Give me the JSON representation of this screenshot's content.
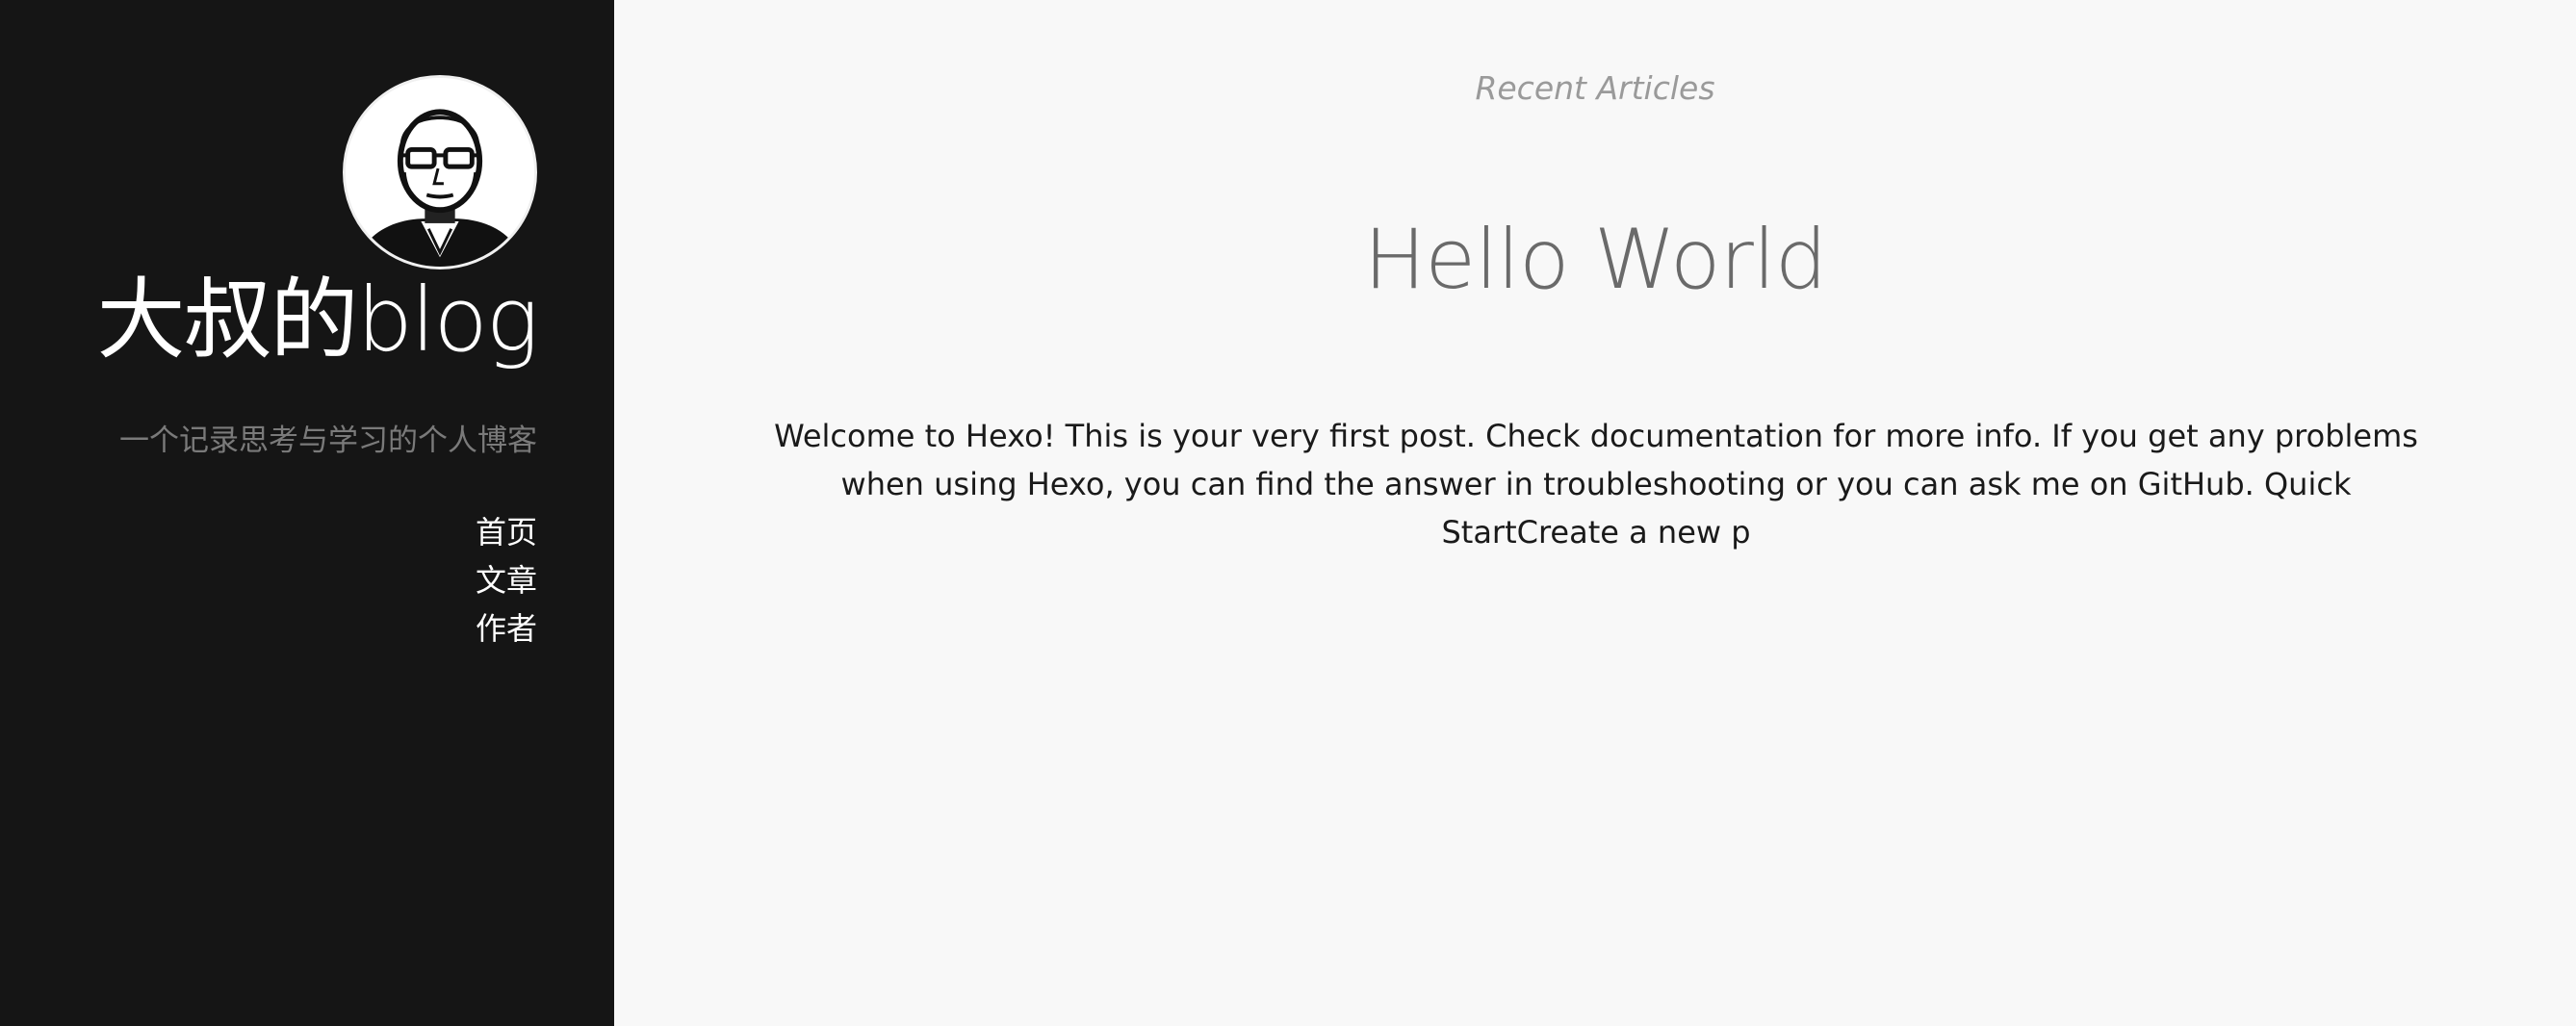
{
  "sidebar": {
    "avatar_alt": "avatar",
    "site_title": "大叔的blog",
    "site_subtitle": "一个记录思考与学习的个人博客",
    "nav": [
      {
        "label": "首页"
      },
      {
        "label": "文章"
      },
      {
        "label": "作者"
      }
    ],
    "background_color": "#151515"
  },
  "main": {
    "section_heading": "Recent Articles",
    "posts": [
      {
        "title": "Hello World",
        "excerpt": "Welcome to Hexo! This is your very first post. Check documentation for more info. If you get any problems when using Hexo, you can find the answer in troubleshooting or you can ask me on GitHub. Quick StartCreate a new p"
      }
    ],
    "background_color": "#f8f8f8"
  }
}
